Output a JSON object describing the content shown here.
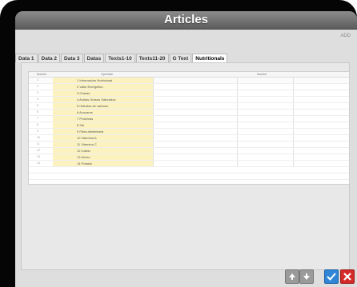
{
  "window": {
    "title": "Articles"
  },
  "corner_label": "ADD",
  "tabs": [
    {
      "label": "Data 1",
      "active": false
    },
    {
      "label": "Data 2",
      "active": false
    },
    {
      "label": "Data 3",
      "active": false
    },
    {
      "label": "Datas",
      "active": false
    },
    {
      "label": "Texts1-10",
      "active": false
    },
    {
      "label": "Texts11-20",
      "active": false
    },
    {
      "label": "G Text",
      "active": false
    },
    {
      "label": "Nutritionals",
      "active": true
    }
  ],
  "grid": {
    "headers": [
      "Number",
      "Operation",
      "Number"
    ],
    "rows": [
      {
        "num": "1",
        "name": "1 Informacion Nutricional"
      },
      {
        "num": "2",
        "name": "2 Valor Energetico"
      },
      {
        "num": "3",
        "name": "3 Grasas"
      },
      {
        "num": "4",
        "name": "4 Acidos Grasos Saturados"
      },
      {
        "num": "5",
        "name": "5 Hidratos de carbono"
      },
      {
        "num": "6",
        "name": "6 Azucares"
      },
      {
        "num": "7",
        "name": "7 Proteinas"
      },
      {
        "num": "8",
        "name": "8 Sal"
      },
      {
        "num": "9",
        "name": "9 Fibra alimentaria"
      },
      {
        "num": "10",
        "name": "10 Vitamina A"
      },
      {
        "num": "11",
        "name": "11 Vitamina C"
      },
      {
        "num": "12",
        "name": "12 Calcio"
      },
      {
        "num": "13",
        "name": "13 Hierro"
      },
      {
        "num": "14",
        "name": "14 Potasio"
      }
    ]
  },
  "colors": {
    "highlight": "#fbf2c0",
    "ok": "#2f86d6",
    "cancel": "#d52a2a"
  },
  "icons": {
    "up": "arrow-up-icon",
    "down": "arrow-down-icon",
    "ok": "check-icon",
    "cancel": "close-icon"
  }
}
